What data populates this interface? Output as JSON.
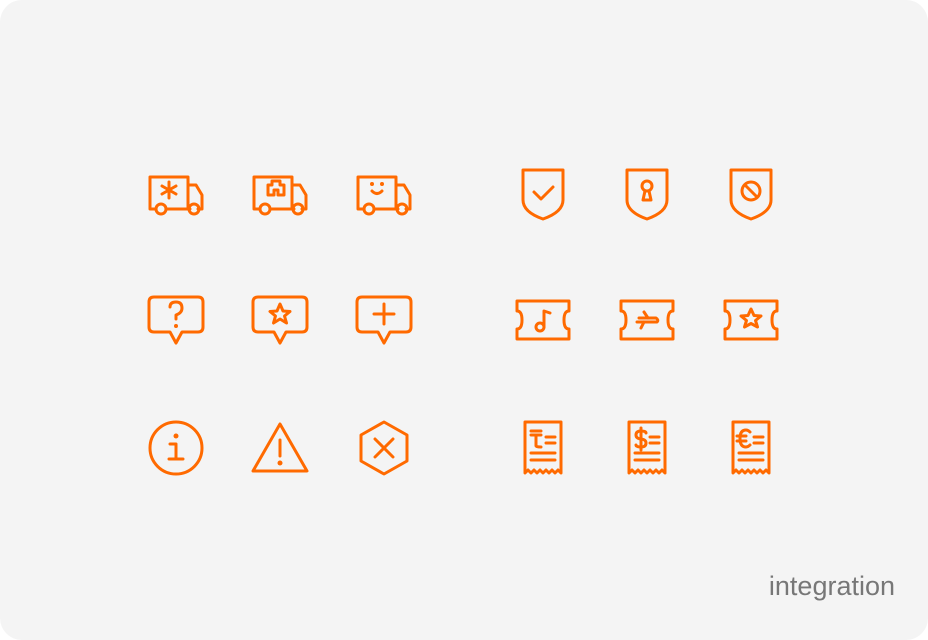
{
  "caption": "integration",
  "accent_color": "#ff6a00",
  "background_color": "#f4f4f4",
  "icons": [
    [
      "ambulance-icon",
      "hospital-van-icon",
      "smile-truck-icon",
      "shield-check-icon",
      "shield-keyhole-icon",
      "shield-prohibited-icon"
    ],
    [
      "chat-question-icon",
      "chat-star-icon",
      "chat-plus-icon",
      "ticket-music-icon",
      "ticket-plane-icon",
      "ticket-star-icon"
    ],
    [
      "info-circle-icon",
      "warning-triangle-icon",
      "hexagon-close-icon",
      "receipt-tenge-icon",
      "receipt-dollar-icon",
      "receipt-euro-icon"
    ]
  ]
}
